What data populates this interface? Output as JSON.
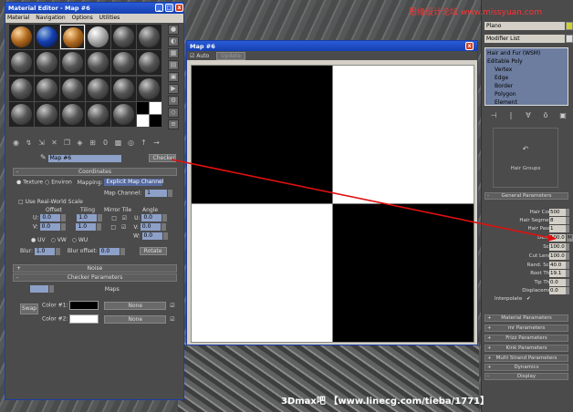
{
  "watermark_top": "思缘设计论坛 www.missyuan.com",
  "watermark_bottom": "3Dmax吧 【www.linecg.com/tieba/1771】",
  "material_editor": {
    "title": "Material Editor - Map #6",
    "menu": [
      "Material",
      "Navigation",
      "Options",
      "Utilities"
    ],
    "map_name": "Map #6",
    "map_type": "Checker",
    "coordinates": {
      "header": "Coordinates",
      "texture": "Texture",
      "environ": "Environ",
      "mapping_label": "Mapping:",
      "mapping_value": "Explicit Map Channel",
      "map_channel_label": "Map Channel:",
      "map_channel_value": "1",
      "use_real_world": "Use Real-World Scale",
      "col_offset": "Offset",
      "col_tiling": "Tiling",
      "col_mirror_tile": "Mirror Tile",
      "col_angle": "Angle",
      "u_label": "U:",
      "v_label": "V:",
      "w_label": "W:",
      "u_offset": "0.0",
      "v_offset": "0.0",
      "u_tiling": "1.0",
      "v_tiling": "1.0",
      "u_angle": "0.0",
      "v_angle": "0.0",
      "w_angle": "0.0",
      "uv": "UV",
      "vw": "VW",
      "wu": "WU",
      "blur_label": "Blur:",
      "blur_value": "1.0",
      "blur_offset_label": "Blur offset:",
      "blur_offset_value": "0.0",
      "rotate": "Rotate"
    },
    "noise_header": "Noise",
    "checker_header": "Checker Parameters",
    "soften_label": "Soften:",
    "soften_value": "0.0",
    "maps_label": "Maps",
    "swap": "Swap",
    "color1_label": "Color #1:",
    "color2_label": "Color #2:",
    "none1": "None",
    "none2": "None",
    "color1": "#000000",
    "color2": "#ffffff"
  },
  "map_window": {
    "title": "Map #6",
    "auto_label": "Auto",
    "update_label": "Update"
  },
  "command_panel": {
    "name_field": "Plano",
    "modifier_list": "Modifier List",
    "stack": [
      "Hair and Fur (WSM)",
      "Editable Poly",
      "Vertex",
      "Edge",
      "Border",
      "Polygon",
      "Element"
    ],
    "hair_groups": "Hair Groups",
    "general_header": "General Parameters",
    "params": [
      {
        "label": "Hair Count",
        "value": "500"
      },
      {
        "label": "Hair Segments",
        "value": "8"
      },
      {
        "label": "Hair Passes",
        "value": "1"
      },
      {
        "label": "Density",
        "value": "100.0"
      },
      {
        "label": "Scale",
        "value": "100.0"
      },
      {
        "label": "Cut Length",
        "value": "100.0"
      },
      {
        "label": "Rand. Scale",
        "value": "40.0"
      },
      {
        "label": "Root Thick",
        "value": "19.1"
      },
      {
        "label": "Tip Thick",
        "value": "0.0"
      },
      {
        "label": "Displacement",
        "value": "0.0"
      }
    ],
    "interpolate": "Interpolate",
    "sections": [
      "Material Parameters",
      "mr Parameters",
      "Frizz Parameters",
      "Kink Parameters",
      "Multi Strand Parameters",
      "Dynamics",
      "Display"
    ]
  },
  "colors": {
    "arrow": "#e01010",
    "title_bar": "#1f4fc4"
  }
}
